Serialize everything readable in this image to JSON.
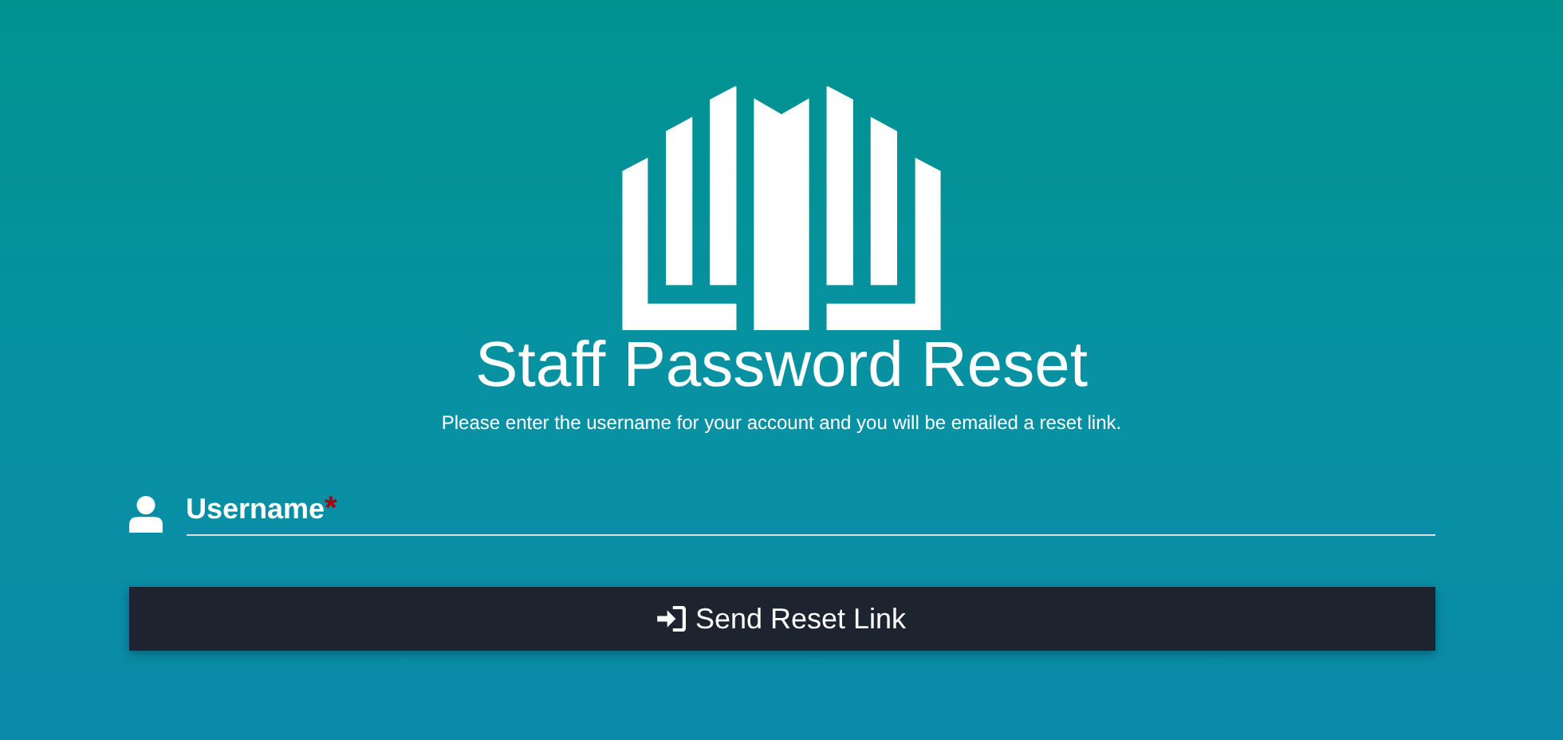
{
  "title": "Staff Password Reset",
  "subtitle": "Please enter the username for your account and you will be emailed a reset link.",
  "username_field": {
    "label": "Username",
    "required": true,
    "required_mark": "*"
  },
  "submit_button": {
    "label": "Send Reset Link"
  }
}
